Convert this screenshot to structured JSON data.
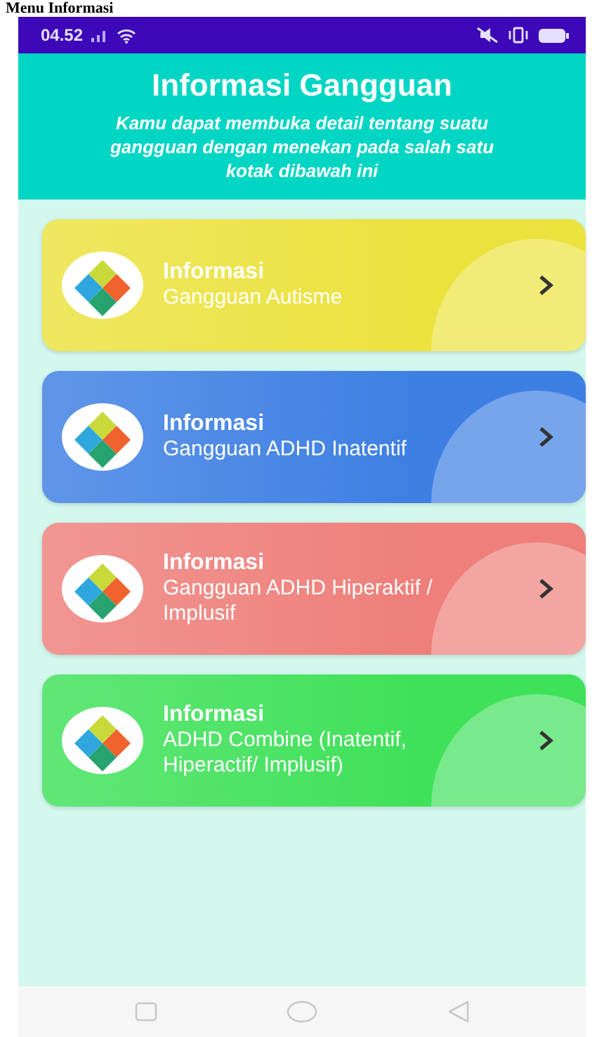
{
  "caption": "Menu Informasi",
  "status_bar": {
    "time": "04.52"
  },
  "header": {
    "title": "Informasi Gangguan",
    "subtitle": "Kamu dapat membuka detail tentang suatu gangguan dengan menekan pada salah satu kotak dibawah ini"
  },
  "cards": [
    {
      "title": "Informasi",
      "subtitle": "Gangguan Autisme",
      "color": "#ebe23e"
    },
    {
      "title": "Informasi",
      "subtitle": "Gangguan ADHD Inatentif",
      "color": "#3d7fe3"
    },
    {
      "title": "Informasi",
      "subtitle": "Gangguan ADHD Hiperaktif / Implusif",
      "color": "#ee7f7a"
    },
    {
      "title": "Informasi",
      "subtitle": "ADHD Combine (Inatentif, Hiperactif/ Implusif)",
      "color": "#3fe159"
    }
  ]
}
